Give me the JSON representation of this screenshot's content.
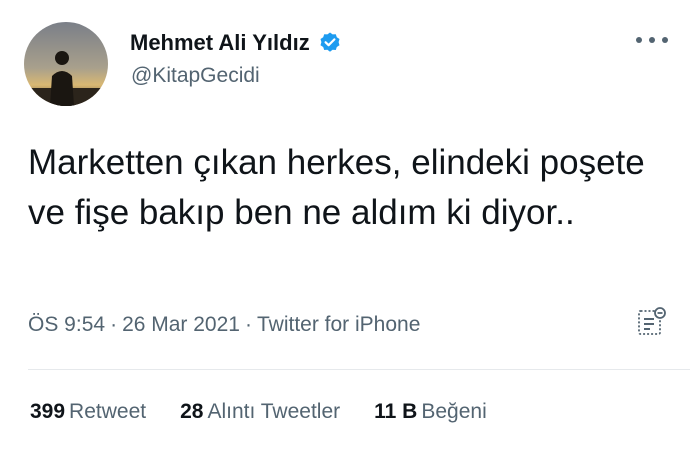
{
  "author": {
    "name": "Mehmet Ali Yıldız",
    "handle": "@KitapGecidi",
    "verified": true,
    "verified_color": "#1d9bf0"
  },
  "tweet": {
    "text": "Marketten çıkan herkes, elindeki poşete ve fişe bakıp ben ne aldım ki diyor..",
    "time": "ÖS 9:54",
    "date": "26 Mar 2021",
    "source": "Twitter for iPhone",
    "separator": "·"
  },
  "stats": {
    "retweets_count": "399",
    "retweets_label": "Retweet",
    "quotes_count": "28",
    "quotes_label": "Alıntı Tweetler",
    "likes_count": "11 B",
    "likes_label": "Beğeni"
  },
  "icons": {
    "more": "more-icon",
    "verified": "verified-badge-icon",
    "analytics": "analytics-icon"
  },
  "colors": {
    "text": "#0f1419",
    "secondary": "#536471",
    "divider": "#e6e9ec"
  }
}
